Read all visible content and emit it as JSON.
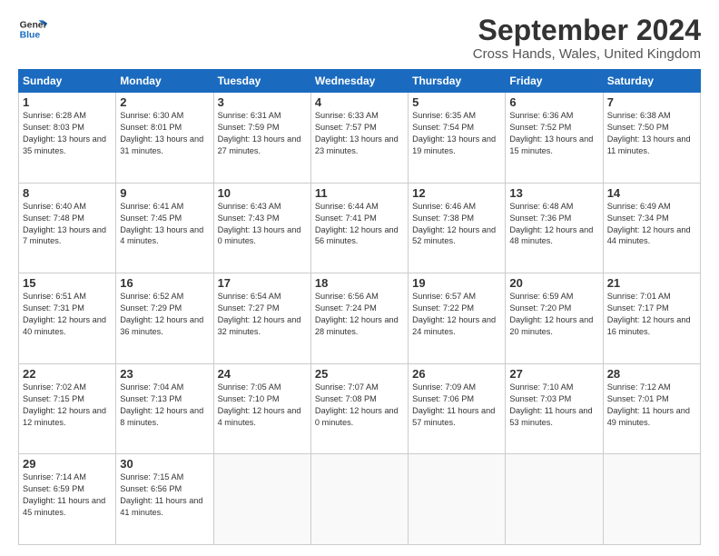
{
  "header": {
    "logo": {
      "line1": "General",
      "line2": "Blue"
    },
    "title": "September 2024",
    "subtitle": "Cross Hands, Wales, United Kingdom"
  },
  "calendar": {
    "days_of_week": [
      "Sunday",
      "Monday",
      "Tuesday",
      "Wednesday",
      "Thursday",
      "Friday",
      "Saturday"
    ],
    "weeks": [
      [
        null,
        null,
        null,
        null,
        null,
        null,
        null,
        {
          "day": "1",
          "sunrise": "Sunrise: 6:28 AM",
          "sunset": "Sunset: 8:03 PM",
          "daylight": "Daylight: 13 hours and 35 minutes."
        },
        {
          "day": "2",
          "sunrise": "Sunrise: 6:30 AM",
          "sunset": "Sunset: 8:01 PM",
          "daylight": "Daylight: 13 hours and 31 minutes."
        },
        {
          "day": "3",
          "sunrise": "Sunrise: 6:31 AM",
          "sunset": "Sunset: 7:59 PM",
          "daylight": "Daylight: 13 hours and 27 minutes."
        },
        {
          "day": "4",
          "sunrise": "Sunrise: 6:33 AM",
          "sunset": "Sunset: 7:57 PM",
          "daylight": "Daylight: 13 hours and 23 minutes."
        },
        {
          "day": "5",
          "sunrise": "Sunrise: 6:35 AM",
          "sunset": "Sunset: 7:54 PM",
          "daylight": "Daylight: 13 hours and 19 minutes."
        },
        {
          "day": "6",
          "sunrise": "Sunrise: 6:36 AM",
          "sunset": "Sunset: 7:52 PM",
          "daylight": "Daylight: 13 hours and 15 minutes."
        },
        {
          "day": "7",
          "sunrise": "Sunrise: 6:38 AM",
          "sunset": "Sunset: 7:50 PM",
          "daylight": "Daylight: 13 hours and 11 minutes."
        }
      ],
      [
        {
          "day": "8",
          "sunrise": "Sunrise: 6:40 AM",
          "sunset": "Sunset: 7:48 PM",
          "daylight": "Daylight: 13 hours and 7 minutes."
        },
        {
          "day": "9",
          "sunrise": "Sunrise: 6:41 AM",
          "sunset": "Sunset: 7:45 PM",
          "daylight": "Daylight: 13 hours and 4 minutes."
        },
        {
          "day": "10",
          "sunrise": "Sunrise: 6:43 AM",
          "sunset": "Sunset: 7:43 PM",
          "daylight": "Daylight: 13 hours and 0 minutes."
        },
        {
          "day": "11",
          "sunrise": "Sunrise: 6:44 AM",
          "sunset": "Sunset: 7:41 PM",
          "daylight": "Daylight: 12 hours and 56 minutes."
        },
        {
          "day": "12",
          "sunrise": "Sunrise: 6:46 AM",
          "sunset": "Sunset: 7:38 PM",
          "daylight": "Daylight: 12 hours and 52 minutes."
        },
        {
          "day": "13",
          "sunrise": "Sunrise: 6:48 AM",
          "sunset": "Sunset: 7:36 PM",
          "daylight": "Daylight: 12 hours and 48 minutes."
        },
        {
          "day": "14",
          "sunrise": "Sunrise: 6:49 AM",
          "sunset": "Sunset: 7:34 PM",
          "daylight": "Daylight: 12 hours and 44 minutes."
        }
      ],
      [
        {
          "day": "15",
          "sunrise": "Sunrise: 6:51 AM",
          "sunset": "Sunset: 7:31 PM",
          "daylight": "Daylight: 12 hours and 40 minutes."
        },
        {
          "day": "16",
          "sunrise": "Sunrise: 6:52 AM",
          "sunset": "Sunset: 7:29 PM",
          "daylight": "Daylight: 12 hours and 36 minutes."
        },
        {
          "day": "17",
          "sunrise": "Sunrise: 6:54 AM",
          "sunset": "Sunset: 7:27 PM",
          "daylight": "Daylight: 12 hours and 32 minutes."
        },
        {
          "day": "18",
          "sunrise": "Sunrise: 6:56 AM",
          "sunset": "Sunset: 7:24 PM",
          "daylight": "Daylight: 12 hours and 28 minutes."
        },
        {
          "day": "19",
          "sunrise": "Sunrise: 6:57 AM",
          "sunset": "Sunset: 7:22 PM",
          "daylight": "Daylight: 12 hours and 24 minutes."
        },
        {
          "day": "20",
          "sunrise": "Sunrise: 6:59 AM",
          "sunset": "Sunset: 7:20 PM",
          "daylight": "Daylight: 12 hours and 20 minutes."
        },
        {
          "day": "21",
          "sunrise": "Sunrise: 7:01 AM",
          "sunset": "Sunset: 7:17 PM",
          "daylight": "Daylight: 12 hours and 16 minutes."
        }
      ],
      [
        {
          "day": "22",
          "sunrise": "Sunrise: 7:02 AM",
          "sunset": "Sunset: 7:15 PM",
          "daylight": "Daylight: 12 hours and 12 minutes."
        },
        {
          "day": "23",
          "sunrise": "Sunrise: 7:04 AM",
          "sunset": "Sunset: 7:13 PM",
          "daylight": "Daylight: 12 hours and 8 minutes."
        },
        {
          "day": "24",
          "sunrise": "Sunrise: 7:05 AM",
          "sunset": "Sunset: 7:10 PM",
          "daylight": "Daylight: 12 hours and 4 minutes."
        },
        {
          "day": "25",
          "sunrise": "Sunrise: 7:07 AM",
          "sunset": "Sunset: 7:08 PM",
          "daylight": "Daylight: 12 hours and 0 minutes."
        },
        {
          "day": "26",
          "sunrise": "Sunrise: 7:09 AM",
          "sunset": "Sunset: 7:06 PM",
          "daylight": "Daylight: 11 hours and 57 minutes."
        },
        {
          "day": "27",
          "sunrise": "Sunrise: 7:10 AM",
          "sunset": "Sunset: 7:03 PM",
          "daylight": "Daylight: 11 hours and 53 minutes."
        },
        {
          "day": "28",
          "sunrise": "Sunrise: 7:12 AM",
          "sunset": "Sunset: 7:01 PM",
          "daylight": "Daylight: 11 hours and 49 minutes."
        }
      ],
      [
        {
          "day": "29",
          "sunrise": "Sunrise: 7:14 AM",
          "sunset": "Sunset: 6:59 PM",
          "daylight": "Daylight: 11 hours and 45 minutes."
        },
        {
          "day": "30",
          "sunrise": "Sunrise: 7:15 AM",
          "sunset": "Sunset: 6:56 PM",
          "daylight": "Daylight: 11 hours and 41 minutes."
        },
        null,
        null,
        null,
        null,
        null
      ]
    ]
  }
}
